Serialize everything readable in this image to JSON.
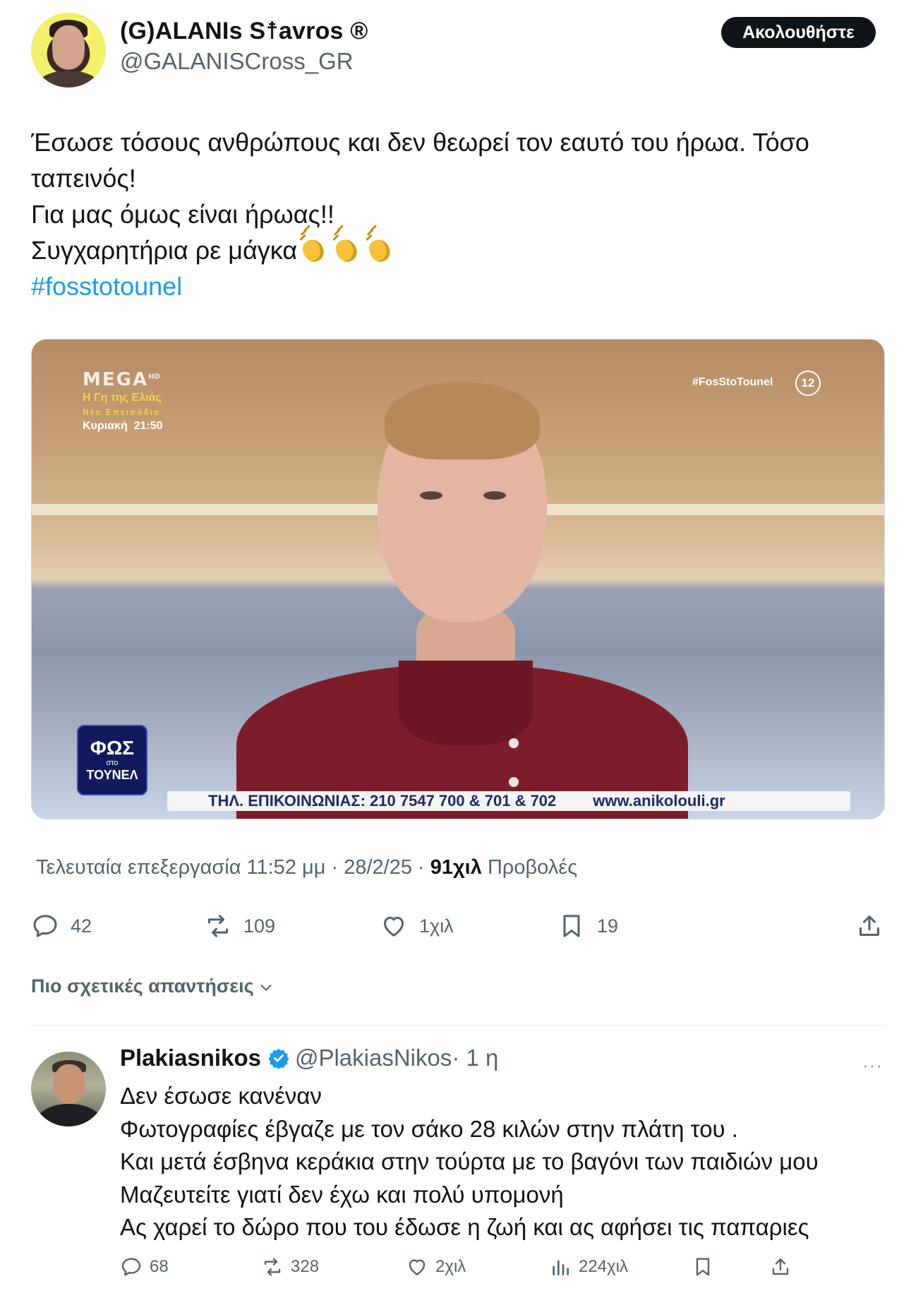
{
  "author": {
    "display_name": "(G)ALANIs S☨avros ®",
    "handle": "@GALANISCross_GR",
    "follow_label": "Ακολουθήστε"
  },
  "tweet": {
    "lines": [
      "Έσωσε τόσους ανθρώπους και δεν θεωρεί τον εαυτό του ήρωα. Τόσο",
      "ταπεινός!",
      "Για μας όμως είναι ήρωας!!",
      "Συγχαρητήρια ρε μάγκα"
    ],
    "hashtag": "#fosstotounel",
    "emoji_icon": "clapping-hands"
  },
  "media": {
    "channel_logo": "MEGA",
    "channel_hd": "HD",
    "promo_show": "Η Γη της Ελιάς",
    "promo_sub": "Νέο Επεισόδιο",
    "promo_day": "Κυριακή",
    "promo_time": "21:50",
    "hashtag_overlay": "#FosStoTounel",
    "rating": "12",
    "show_logo_line1": "ΦΩΣ",
    "show_logo_line2": "στο",
    "show_logo_line3": "ΤΟΥΝΕΛ",
    "ticker_phone": "ΤΗΛ. ΕΠΙΚΟΙΝΩΝΙΑΣ: 210 7547 700 & 701 & 702",
    "ticker_url": "www.anikolouli.gr"
  },
  "meta": {
    "edited": "Τελευταία επεξεργασία 11:52 μμ · 28/2/25",
    "separator": " · ",
    "views_count": "91χιλ",
    "views_label": "Προβολές"
  },
  "actions": {
    "replies": "42",
    "reposts": "109",
    "likes": "1χιλ",
    "bookmarks": "19"
  },
  "related_label": "Πιο σχετικές απαντήσεις",
  "reply": {
    "display_name": "Plakiasnikos",
    "handle": "@PlakiasNikos",
    "time": "· 1 η",
    "more": "···",
    "lines": [
      "Δεν έσωσε κανέναν",
      "Φωτογραφίες έβγαζε με τον σάκο 28 κιλών στην πλάτη του .",
      "Και μετά έσβηνα κεράκια στην τούρτα με το βαγόνι των παιδιών μου",
      "Μαζευτείτε γιατί δεν έχω και πολύ υπομονή",
      "Ας χαρεί το δώρο που του έδωσε η ζωή και ας αφήσει τις παπαριες"
    ],
    "actions": {
      "replies": "68",
      "reposts": "328",
      "likes": "2χιλ",
      "views": "224χιλ"
    }
  },
  "colors": {
    "accent": "#1d9bf0",
    "text": "#0f1419",
    "muted": "#536471"
  }
}
